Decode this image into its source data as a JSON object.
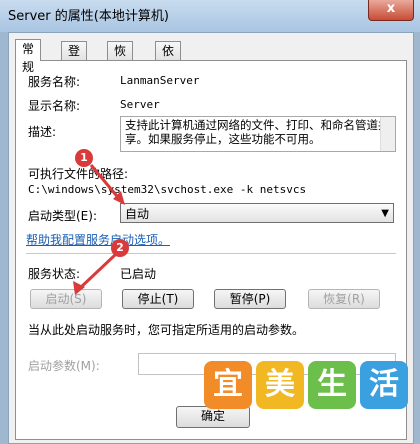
{
  "window": {
    "title": "Server 的属性(本地计算机)",
    "close_glyph": "x"
  },
  "tabs": [
    {
      "label": "常规",
      "active": true
    },
    {
      "label": "登录",
      "active": false
    },
    {
      "label": "恢复",
      "active": false
    },
    {
      "label": "依存关系",
      "active": false
    }
  ],
  "general": {
    "service_name_label": "服务名称:",
    "service_name": "LanmanServer",
    "display_name_label": "显示名称:",
    "display_name": "Server",
    "description_label": "描述:",
    "description": "支持此计算机通过网络的文件、打印、和命名管道共享。如果服务停止，这些功能不可用。",
    "exe_path_label": "可执行文件的路径:",
    "exe_path": "C:\\windows\\system32\\svchost.exe -k netsvcs",
    "startup_type_label": "启动类型(E):",
    "startup_type_value": "自动",
    "help_link": "帮助我配置服务启动选项。",
    "status_label": "服务状态:",
    "status_value": "已启动",
    "buttons": {
      "start": "启动(S)",
      "stop": "停止(T)",
      "pause": "暂停(P)",
      "resume": "恢复(R)"
    },
    "hint": "当从此处启动服务时，您可指定所适用的启动参数。",
    "start_params_label": "启动参数(M):",
    "ok_button": "确定"
  },
  "annotations": {
    "badge1": "1",
    "badge2": "2",
    "accent": "#d93a3a"
  },
  "watermark": [
    "宜",
    "美",
    "生",
    "活"
  ]
}
